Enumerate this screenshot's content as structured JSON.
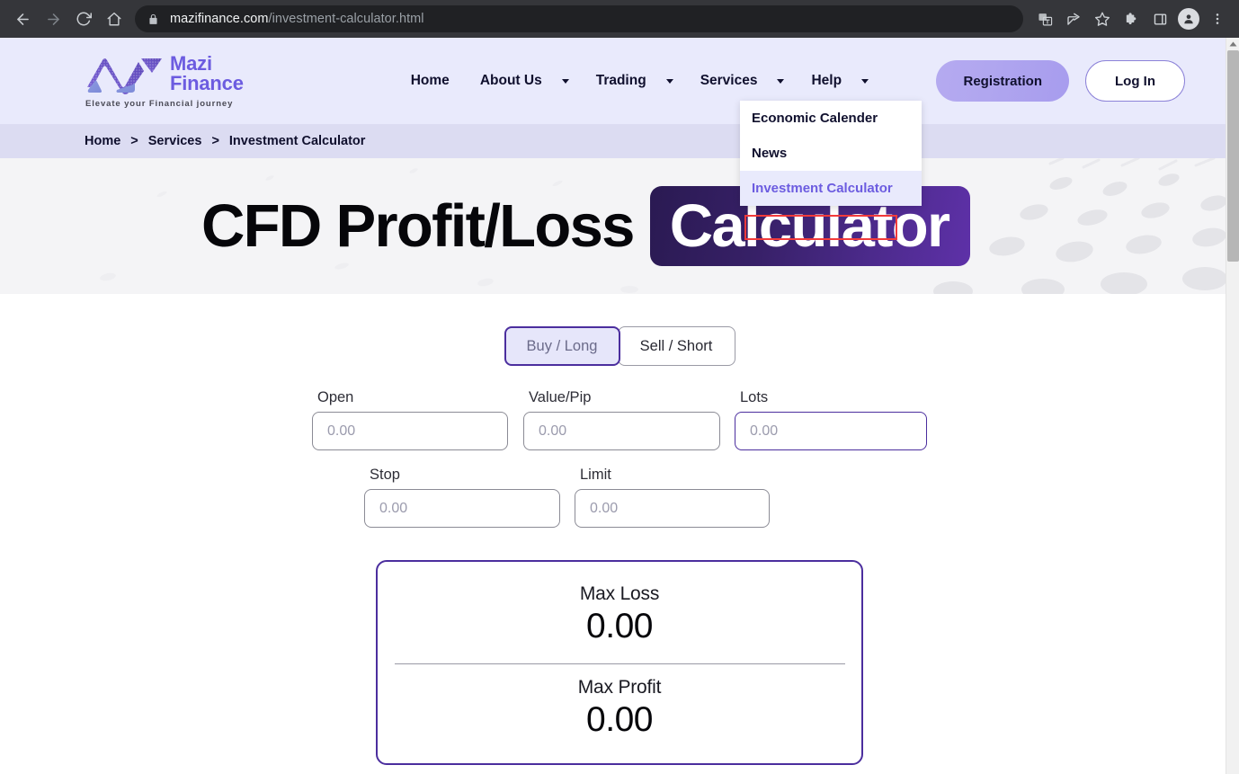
{
  "browser": {
    "back_label": "back-navigation",
    "forward_label": "forward-navigation",
    "reload_label": "reload",
    "home_label": "home",
    "url_domain": "mazifinance.com",
    "url_path": "/investment-calculator.html",
    "icons": [
      "translate-icon",
      "share-icon",
      "bookmark-star-icon",
      "extensions-puzzle-icon",
      "sidepanel-icon",
      "profile-avatar-icon",
      "chrome-menu-icon"
    ]
  },
  "site": {
    "logo": {
      "line1": "Mazi",
      "line2": "Finance",
      "tagline": "Elevate your Financial journey"
    },
    "nav": [
      {
        "label": "Home",
        "has_caret": false
      },
      {
        "label": "About Us",
        "has_caret": true
      },
      {
        "label": "Trading",
        "has_caret": true
      },
      {
        "label": "Services",
        "has_caret": true
      },
      {
        "label": "Help",
        "has_caret": true
      }
    ],
    "actions": {
      "register": "Registration",
      "login": "Log In"
    },
    "dropdown": {
      "items": [
        {
          "label": "Economic Calender",
          "hovered": false
        },
        {
          "label": "News",
          "hovered": false
        },
        {
          "label": "Investment Calculator",
          "hovered": true
        }
      ],
      "highlight_color": "#f23b3b"
    },
    "breadcrumb": {
      "items": [
        "Home",
        "Services",
        "Investment Calculator"
      ],
      "separator": ">"
    }
  },
  "hero": {
    "title": "CFD Profit/Loss",
    "badge": "Calculator"
  },
  "calculator": {
    "toggle": {
      "buy": "Buy / Long",
      "sell": "Sell / Short",
      "active": "Buy / Long"
    },
    "fields_row1": [
      {
        "label": "Open",
        "value": "",
        "placeholder": "0.00",
        "focused": false
      },
      {
        "label": "Value/Pip",
        "value": "",
        "placeholder": "0.00",
        "focused": false
      },
      {
        "label": "Lots",
        "value": "",
        "placeholder": "0.00",
        "focused": true
      }
    ],
    "fields_row2": [
      {
        "label": "Stop",
        "value": "",
        "placeholder": "0.00",
        "focused": false
      },
      {
        "label": "Limit",
        "value": "",
        "placeholder": "0.00",
        "focused": false
      }
    ],
    "results": {
      "max_loss_label": "Max Loss",
      "max_loss_value": "0.00",
      "max_profit_label": "Max Profit",
      "max_profit_value": "0.00"
    }
  },
  "colors": {
    "brand_purple": "#6c5ce0",
    "deep_purple": "#4b2e9e",
    "header_bg": "#e9eafc",
    "breadcrumb_bg": "#dcdcf2"
  }
}
